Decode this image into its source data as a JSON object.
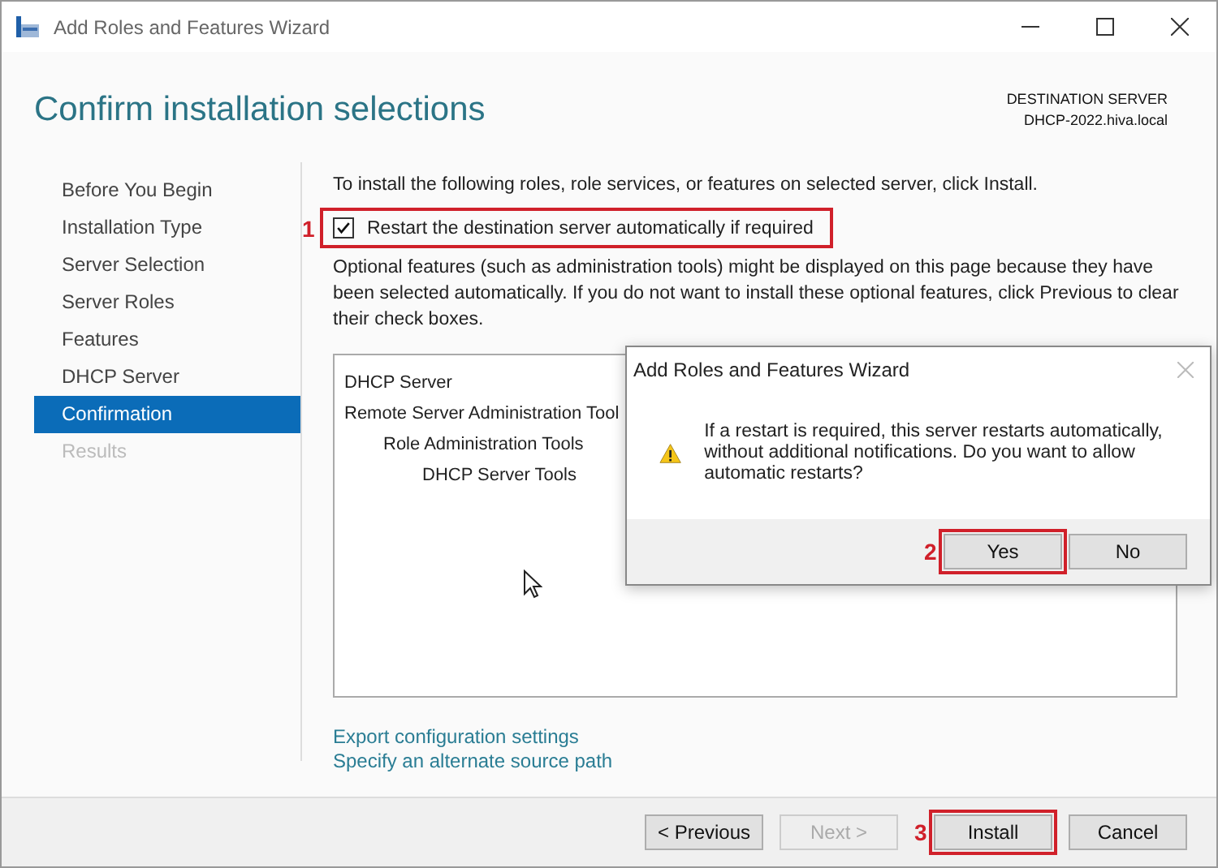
{
  "window": {
    "title": "Add Roles and Features Wizard"
  },
  "header": {
    "title": "Confirm installation selections",
    "destination_label": "DESTINATION SERVER",
    "destination_server": "DHCP-2022.hiva.local"
  },
  "sidebar": {
    "items": [
      {
        "label": "Before You Begin",
        "selected": false,
        "disabled": false
      },
      {
        "label": "Installation Type",
        "selected": false,
        "disabled": false
      },
      {
        "label": "Server Selection",
        "selected": false,
        "disabled": false
      },
      {
        "label": "Server Roles",
        "selected": false,
        "disabled": false
      },
      {
        "label": "Features",
        "selected": false,
        "disabled": false
      },
      {
        "label": "DHCP Server",
        "selected": false,
        "disabled": false
      },
      {
        "label": "Confirmation",
        "selected": true,
        "disabled": false
      },
      {
        "label": "Results",
        "selected": false,
        "disabled": true
      }
    ]
  },
  "content": {
    "intro": "To install the following roles, role services, or features on selected server, click Install.",
    "restart_option": {
      "label": "Restart the destination server automatically if required",
      "checked": true,
      "marker": "1"
    },
    "note": "Optional features (such as administration tools) might be displayed on this page because they have been selected automatically. If you do not want to install these optional features, click Previous to clear their check boxes.",
    "features": [
      {
        "label": "DHCP Server"
      },
      {
        "label": "Remote Server Administration Tool",
        "children": [
          {
            "label": "Role Administration Tools",
            "children": [
              {
                "label": "DHCP Server Tools"
              }
            ]
          }
        ]
      }
    ],
    "links": [
      "Export configuration settings",
      "Specify an alternate source path"
    ]
  },
  "dialog": {
    "title": "Add Roles and Features Wizard",
    "message": "If a restart is required, this server restarts automatically, without additional notifications. Do you want to allow automatic restarts?",
    "buttons": [
      {
        "label": "Yes",
        "marker": "2"
      },
      {
        "label": "No"
      }
    ]
  },
  "buttons": [
    {
      "label": "< Previous",
      "disabled": false
    },
    {
      "label": "Next >",
      "disabled": true
    },
    {
      "label": "Install",
      "disabled": false,
      "marker": "3"
    },
    {
      "label": "Cancel",
      "disabled": false
    }
  ]
}
